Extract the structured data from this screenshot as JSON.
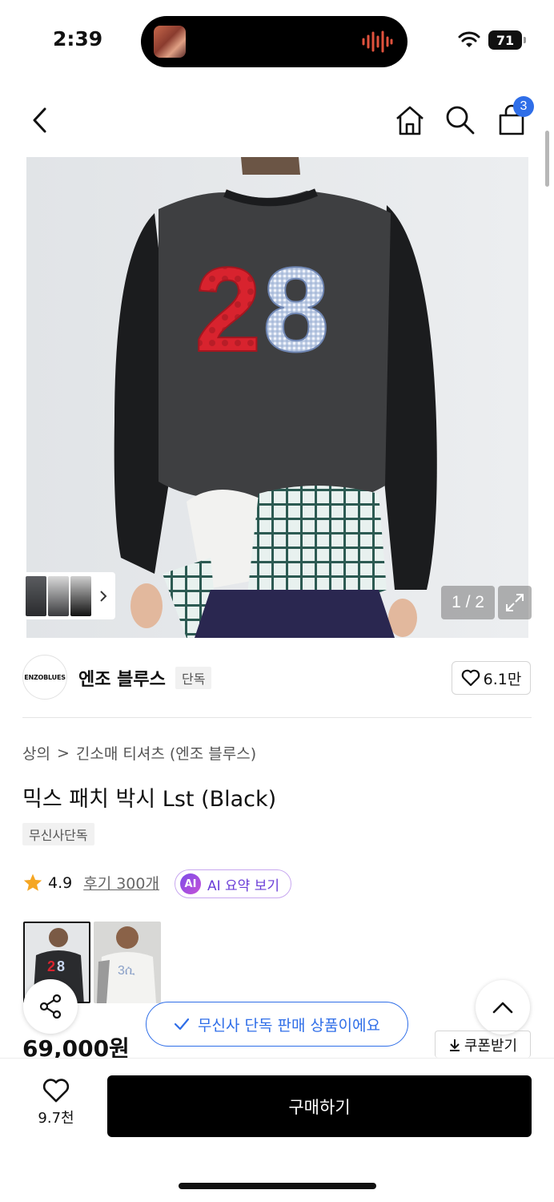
{
  "status_bar": {
    "time": "2:39",
    "battery": "71"
  },
  "nav": {
    "cart_count": "3"
  },
  "gallery": {
    "counter": "1 / 2",
    "print_number": "28"
  },
  "brand": {
    "logo_text": "ENZOBLUES",
    "name": "엔조 블루스",
    "tag": "단독",
    "likes": "6.1만"
  },
  "breadcrumb": {
    "category": "상의",
    "separator": ">",
    "subcategory": "긴소매 티셔츠 (엔조 블루스)"
  },
  "product": {
    "title": "믹스 패치 박시 Lst (Black)",
    "exclusive_tag": "무신사단독",
    "rating": "4.9",
    "review_link": "후기 300개",
    "ai_badge": "AI",
    "ai_summary": "AI 요약 보기",
    "price": "69,000원"
  },
  "toast": {
    "message": "무신사 단독 판매 상품이에요"
  },
  "coupon": {
    "label": "쿠폰받기"
  },
  "bottom": {
    "wish_count": "9.7천",
    "buy_label": "구매하기"
  },
  "colors": {
    "accent_blue": "#2f6ee8",
    "ai_purple": "#6b3fd8",
    "star": "#f5a623"
  },
  "icons": [
    "back-icon",
    "home-icon",
    "search-icon",
    "cart-icon",
    "expand-icon",
    "heart-icon",
    "star-icon",
    "share-icon",
    "chevron-up-icon",
    "check-icon",
    "download-icon",
    "wifi-icon"
  ]
}
